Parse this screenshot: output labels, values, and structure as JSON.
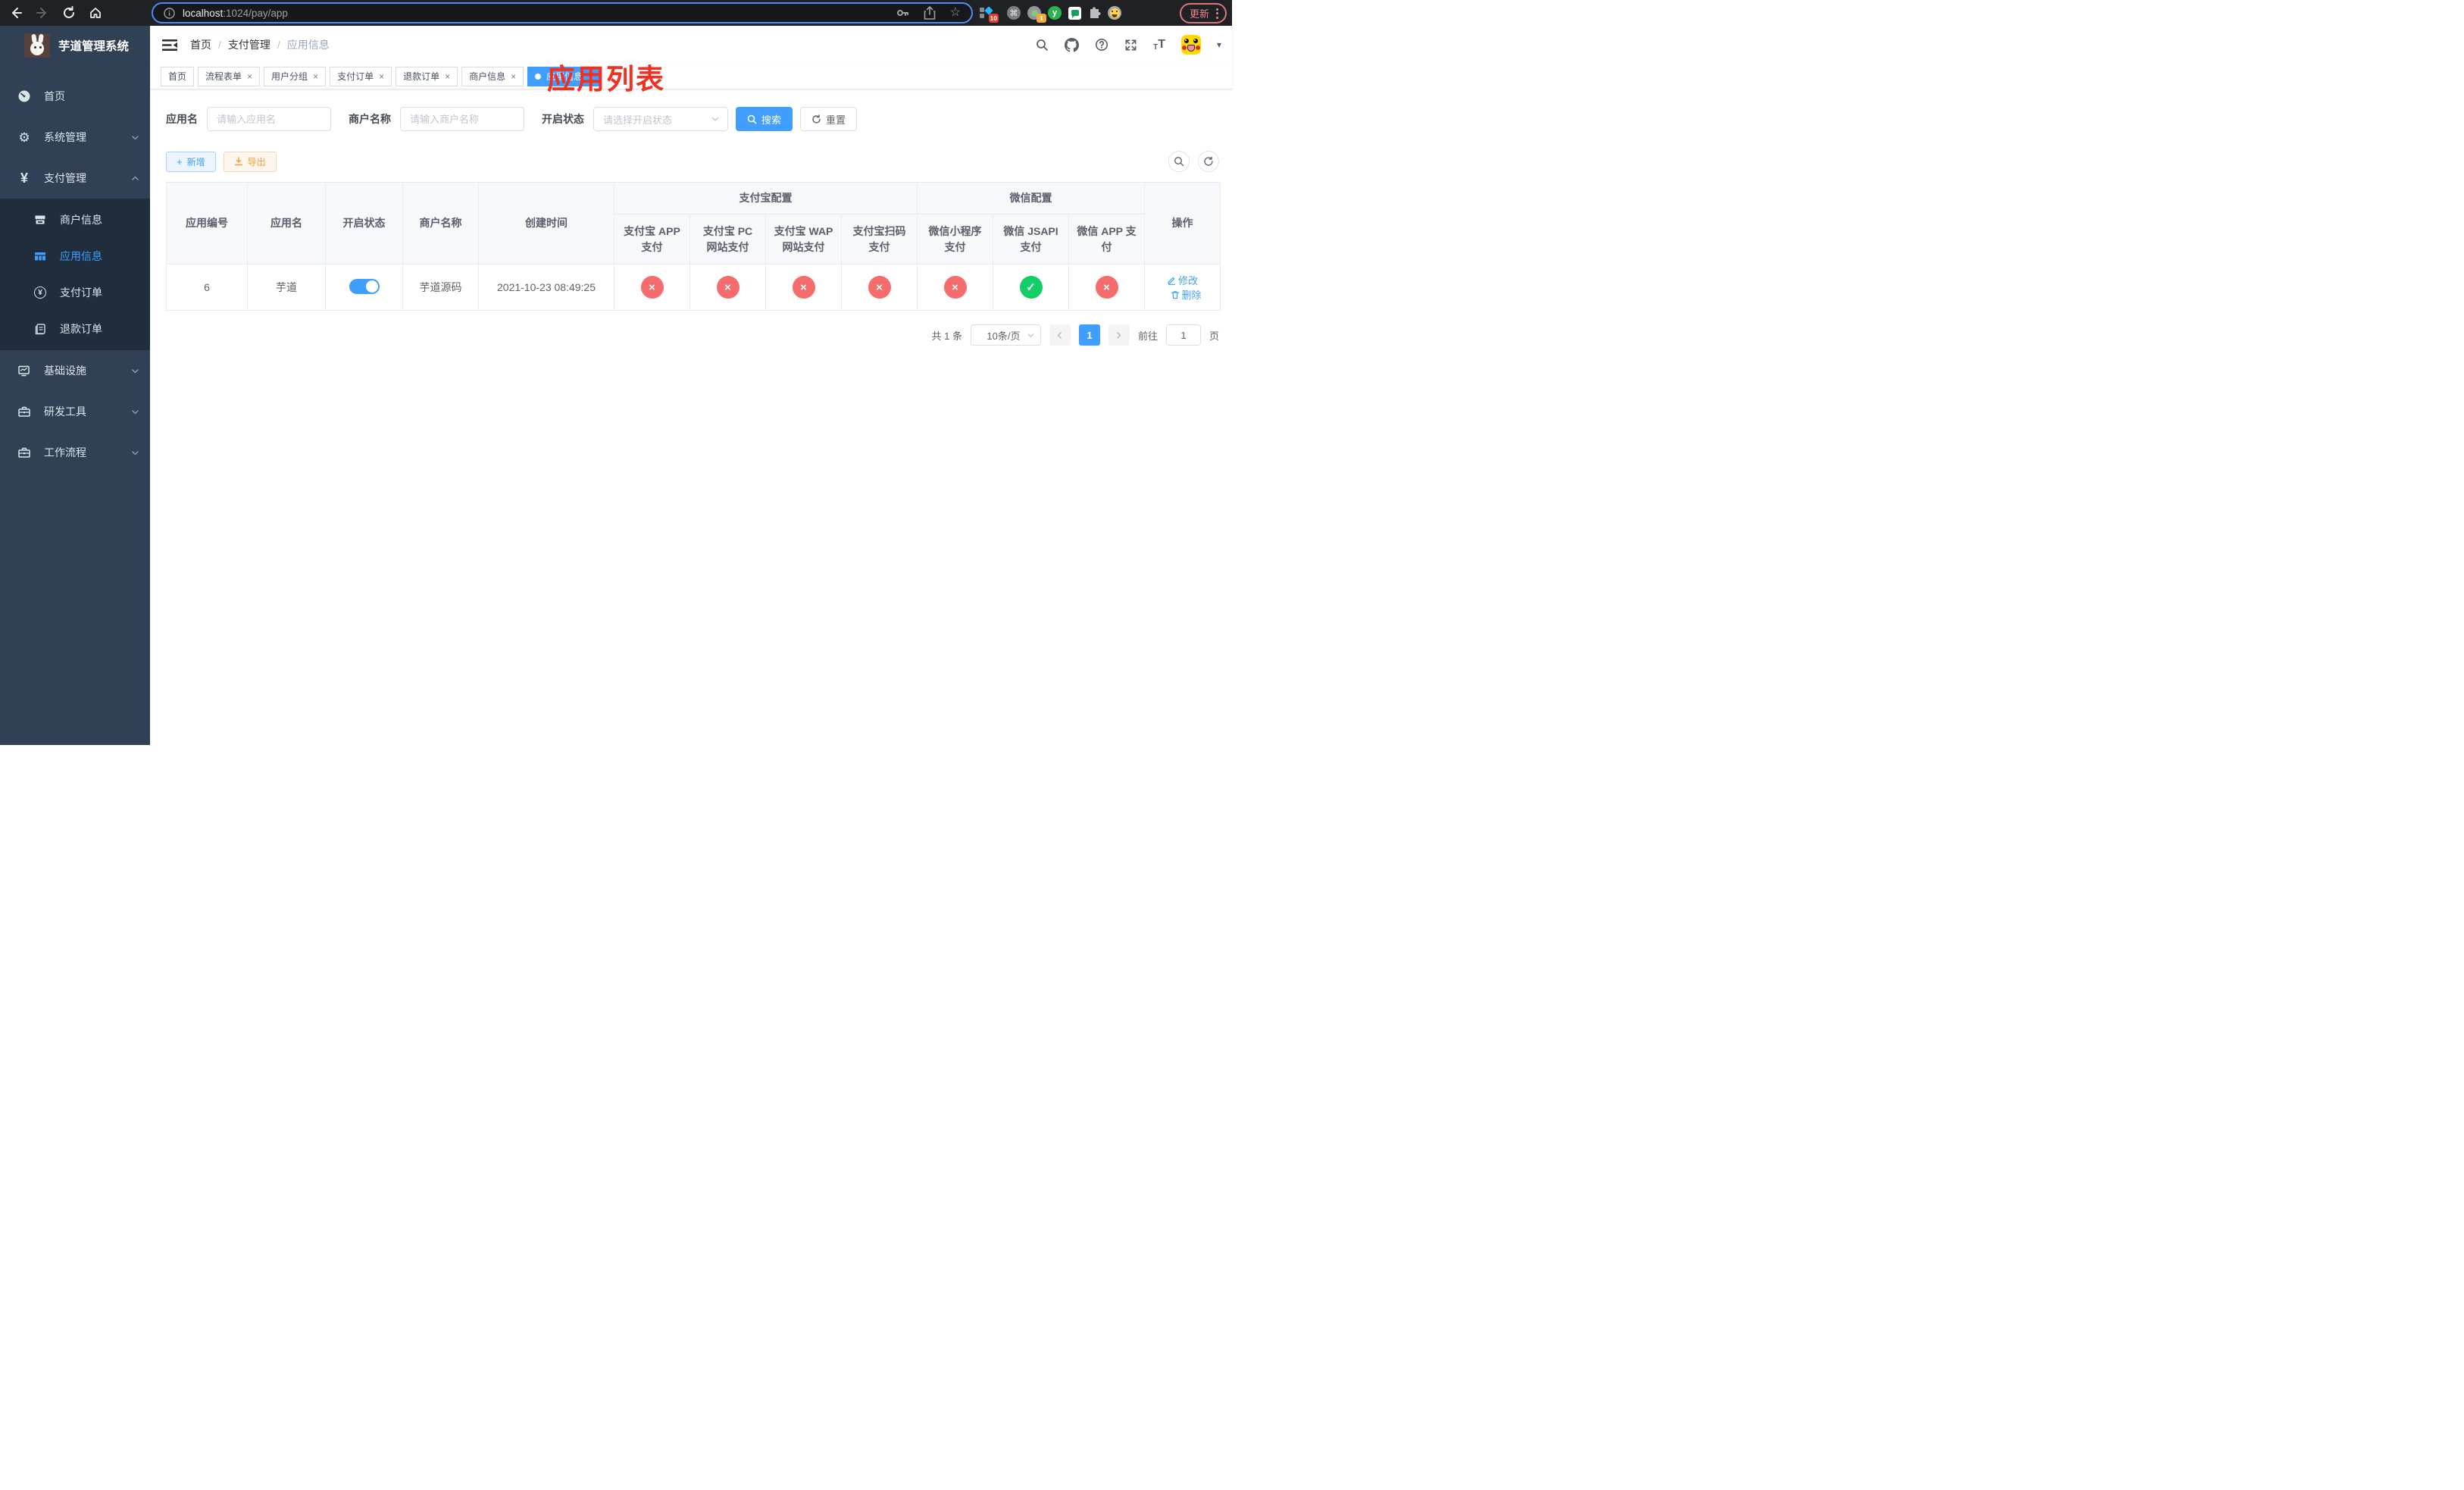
{
  "colors": {
    "accent": "#409eff",
    "success": "#13ce66",
    "danger": "#f56c6c",
    "warning": "#e6a23c",
    "annotation_red": "#f1301f",
    "sidebar_bg": "#304156",
    "submenu_bg": "#1f2d3d"
  },
  "browser": {
    "url_host": "localhost",
    "url_path": ":1024/pay/app",
    "update_label": "更新",
    "ext_badge_red": "10",
    "ext_badge_orange": "1",
    "ext_y_letter": "y"
  },
  "icons": {
    "command": "⌘",
    "star": "☆",
    "gear": "⚙",
    "yen": "¥",
    "caret": "▾",
    "close": "×",
    "plus": "+",
    "t_small": "T",
    "t_big": "T"
  },
  "sidebar": {
    "title": "芋道管理系统",
    "menu": [
      {
        "label": "首页"
      },
      {
        "label": "系统管理"
      },
      {
        "label": "支付管理"
      }
    ],
    "submenu": [
      {
        "label": "商户信息"
      },
      {
        "label": "应用信息",
        "active": true
      },
      {
        "label": "支付订单"
      },
      {
        "label": "退款订单"
      }
    ],
    "menu2": [
      {
        "label": "基础设施"
      },
      {
        "label": "研发工具"
      },
      {
        "label": "工作流程"
      }
    ]
  },
  "header": {
    "breadcrumb": [
      "首页",
      "支付管理",
      "应用信息"
    ],
    "separator": "/"
  },
  "annotation": "应用列表",
  "tabs": [
    {
      "label": "首页"
    },
    {
      "label": "流程表单"
    },
    {
      "label": "用户分组"
    },
    {
      "label": "支付订单"
    },
    {
      "label": "退款订单"
    },
    {
      "label": "商户信息"
    },
    {
      "label": "应用信息"
    }
  ],
  "filters": {
    "app_name_label": "应用名",
    "app_name_placeholder": "请输入应用名",
    "merchant_label": "商户名称",
    "merchant_placeholder": "请输入商户名称",
    "status_label": "开启状态",
    "status_placeholder": "请选择开启状态",
    "search_label": "搜索",
    "reset_label": "重置"
  },
  "toolbar": {
    "add_label": "新增",
    "export_label": "导出"
  },
  "table": {
    "headers": {
      "app_id": "应用编号",
      "app_name": "应用名",
      "status": "开启状态",
      "merchant": "商户名称",
      "created": "创建时间",
      "alipay_group": "支付宝配置",
      "wechat_group": "微信配置",
      "alipay": [
        "支付宝 APP 支付",
        "支付宝 PC 网站支付",
        "支付宝 WAP 网站支付",
        "支付宝扫码支付"
      ],
      "wechat": [
        "微信小程序支付",
        "微信 JSAPI 支付",
        "微信 APP 支付"
      ],
      "ops": "操作"
    },
    "row": {
      "id": "6",
      "name": "芋道",
      "enabled": true,
      "merchant": "芋道源码",
      "created": "2021-10-23 08:49:25",
      "configs": [
        false,
        false,
        false,
        false,
        false,
        true,
        false
      ],
      "edit_label": "修改",
      "delete_label": "删除"
    }
  },
  "pagination": {
    "total": "共 1 条",
    "page_size": "10条/页",
    "page": "1",
    "goto_prefix": "前往",
    "goto_value": "1",
    "goto_suffix": "页"
  }
}
